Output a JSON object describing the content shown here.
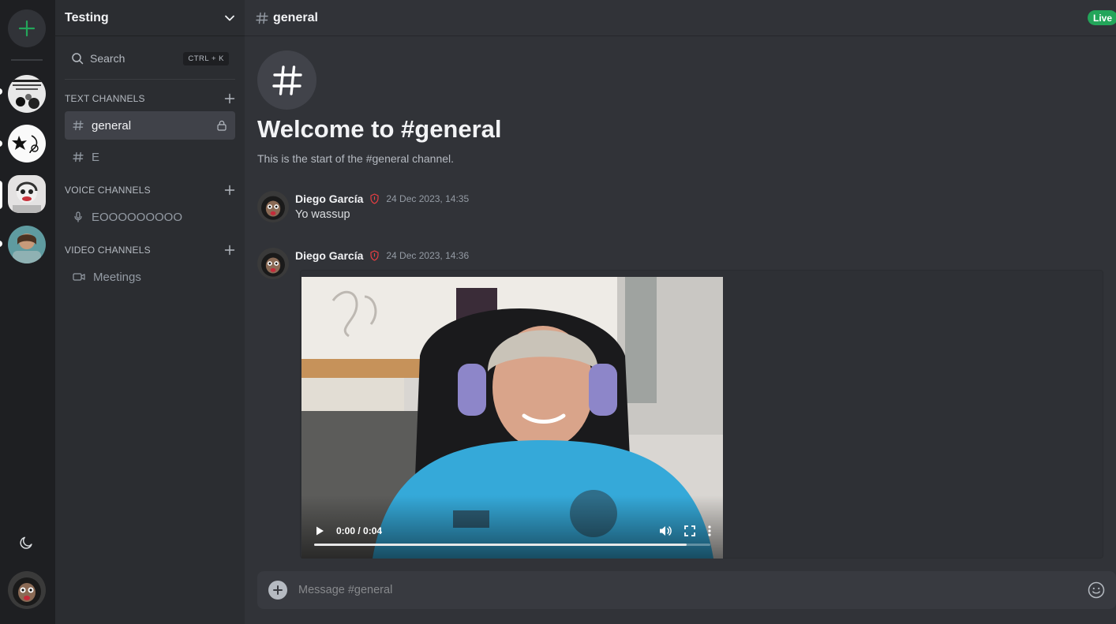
{
  "server": {
    "name": "Testing",
    "search_label": "Search",
    "search_shortcut": "CTRL + K"
  },
  "categories": {
    "text": "TEXT CHANNELS",
    "voice": "VOICE CHANNELS",
    "video": "VIDEO CHANNELS"
  },
  "channels": {
    "text": [
      {
        "name": "general"
      },
      {
        "name": "E"
      }
    ],
    "voice": [
      {
        "name": "EOOOOOOOOO"
      }
    ],
    "video": [
      {
        "name": "Meetings"
      }
    ]
  },
  "header": {
    "channel": "general",
    "live_badge": "Live"
  },
  "welcome": {
    "title": "Welcome to #general",
    "subtitle": "This is the start of the #general channel."
  },
  "messages": [
    {
      "author": "Diego García",
      "timestamp": "24 Dec 2023, 14:35",
      "text": "Yo wassup"
    },
    {
      "author": "Diego García",
      "timestamp": "24 Dec 2023, 14:36",
      "text": ""
    }
  ],
  "video": {
    "time": "0:00 / 0:04",
    "progress": 0.94
  },
  "composer": {
    "placeholder": "Message #general"
  },
  "colors": {
    "accent_green": "#23a55a",
    "rail_bg": "#1e1f22",
    "sidebar_bg": "#2b2d31",
    "main_bg": "#313338"
  }
}
